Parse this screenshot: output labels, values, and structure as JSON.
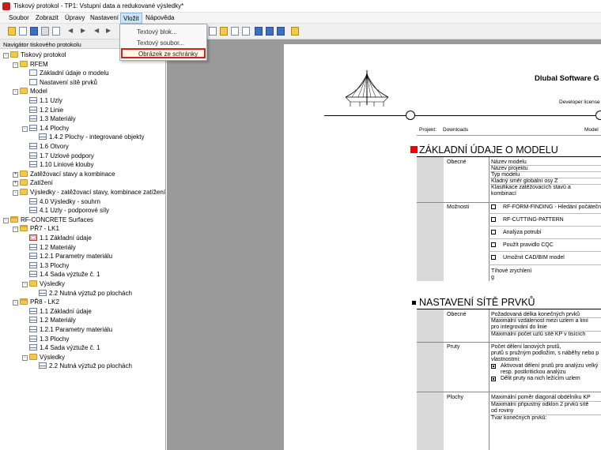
{
  "window": {
    "title": "Tiskový protokol - TP1: Vstupní data a redukované výsledky*"
  },
  "menu": {
    "items": [
      "Soubor",
      "Zobrazit",
      "Úpravy",
      "Nastavení",
      "Vložit",
      "Nápověda"
    ],
    "active": "Vložit"
  },
  "dropdown": {
    "items": [
      "Textový blok...",
      "Textový soubor...",
      "Obrázek ze schránky"
    ],
    "highlighted": "Obrázek ze schránky"
  },
  "navigator": {
    "title": "Navigátor tiskového protokolu",
    "tree": [
      {
        "label": "Tiskový protokol",
        "icon": "folder-icon",
        "toggle": "-"
      },
      {
        "label": "RFEM",
        "icon": "folder-icon",
        "toggle": "-"
      },
      {
        "label": "Základní údaje o modelu",
        "icon": "document-icon",
        "toggle": ""
      },
      {
        "label": "Nastavení sítě prvků",
        "icon": "document-icon",
        "toggle": ""
      },
      {
        "label": "Model",
        "icon": "folder-icon",
        "toggle": "-"
      },
      {
        "label": "1.1 Uzly",
        "icon": "table-icon",
        "toggle": ""
      },
      {
        "label": "1.2 Linie",
        "icon": "table-icon",
        "toggle": ""
      },
      {
        "label": "1.3 Materiály",
        "icon": "table-icon",
        "toggle": ""
      },
      {
        "label": "1.4 Plochy",
        "icon": "table-icon",
        "toggle": "-"
      },
      {
        "label": "1.4.2 Plochy - integrované objekty",
        "icon": "table-icon",
        "toggle": ""
      },
      {
        "label": "1.6 Otvory",
        "icon": "table-icon",
        "toggle": ""
      },
      {
        "label": "1.7 Uzlové podpory",
        "icon": "table-icon",
        "toggle": ""
      },
      {
        "label": "1.10 Liniové klouby",
        "icon": "table-icon",
        "toggle": ""
      },
      {
        "label": "Zatěžovací stavy a kombinace",
        "icon": "folder-icon",
        "toggle": "+"
      },
      {
        "label": "Zatížení",
        "icon": "folder-icon",
        "toggle": "+"
      },
      {
        "label": "Výsledky - zatěžovací stavy, kombinace zatížení",
        "icon": "folder-icon",
        "toggle": "-"
      },
      {
        "label": "4.0 Výsledky - souhrn",
        "icon": "table-icon",
        "toggle": ""
      },
      {
        "label": "4.1 Uzly - podporové síly",
        "icon": "table-icon",
        "toggle": ""
      },
      {
        "label": "RF-CONCRETE Surfaces",
        "icon": "module-folder-icon",
        "toggle": "-"
      },
      {
        "label": "PŘ7 - LK1",
        "icon": "module-folder-icon",
        "toggle": "-"
      },
      {
        "label": "1.1 Základní údaje",
        "icon": "red-table-icon",
        "toggle": ""
      },
      {
        "label": "1.2 Materiály",
        "icon": "table-icon",
        "toggle": ""
      },
      {
        "label": "1.2.1 Parametry materiálu",
        "icon": "table-icon",
        "toggle": ""
      },
      {
        "label": "1.3 Plochy",
        "icon": "table-icon",
        "toggle": ""
      },
      {
        "label": "1.4 Sada výztuže č. 1",
        "icon": "table-icon",
        "toggle": ""
      },
      {
        "label": "Výsledky",
        "icon": "folder-icon",
        "toggle": "-"
      },
      {
        "label": "2.2 Nutná výztuž po plochách",
        "icon": "table-icon",
        "toggle": ""
      },
      {
        "label": "PŘ8 - LK2",
        "icon": "module-folder-icon",
        "toggle": "-"
      },
      {
        "label": "1.1 Základní údaje",
        "icon": "table-icon",
        "toggle": ""
      },
      {
        "label": "1.2 Materiály",
        "icon": "table-icon",
        "toggle": ""
      },
      {
        "label": "1.2.1 Parametry materiálu",
        "icon": "table-icon",
        "toggle": ""
      },
      {
        "label": "1.3 Plochy",
        "icon": "table-icon",
        "toggle": ""
      },
      {
        "label": "1.4 Sada výztuže č. 1",
        "icon": "table-icon",
        "toggle": ""
      },
      {
        "label": "Výsledky",
        "icon": "folder-icon",
        "toggle": "-"
      },
      {
        "label": "2.2 Nutná výztuž po plochách",
        "icon": "table-icon",
        "toggle": ""
      }
    ]
  },
  "report": {
    "company": "Dlubal Software G",
    "license": "Developer license",
    "project_label": "Projekt:",
    "project_value": "Downloads",
    "model_label": "Model",
    "section1": {
      "title": "ZÁKLADNÍ ÚDAJE O MODELU",
      "group1_label": "Obecné",
      "group1_rows": [
        "Název modelu",
        "Název projektu",
        "Typ modelu",
        "Kladný směr globální osy Z",
        "Klasifikace zatěžovacích stavů a",
        "kombinací"
      ],
      "group2_label": "Možnosti",
      "options": [
        {
          "label": "RF-FORM-FINDING - Hledání počátečn",
          "checked": false
        },
        {
          "label": "RF-CUTTING-PATTERN",
          "checked": false
        },
        {
          "label": "Analýza potrubí",
          "checked": false
        },
        {
          "label": "Použít pravidlo CQC",
          "checked": false
        },
        {
          "label": "Umožnit CAD/BIM model",
          "checked": false
        }
      ],
      "gravity_label": "Tíhové zrychlení",
      "gravity_symbol": "g"
    },
    "section2": {
      "title": "NASTAVENÍ SÍTĚ PRVKŮ",
      "general_label": "Obecné",
      "general_rows": [
        "Požadovaná délka konečných prvků",
        "Maximální vzdálenost mezi uzlem a linií",
        "pro integrování do linie",
        "Maximální počet uzlů sítě KP v tisících"
      ],
      "members_label": "Pruty",
      "members_rows": [
        "Počet dělení lanových prutů,",
        "prutů s pružným podložím, s náběhy nebo p",
        "vlastnostmi:"
      ],
      "member_options": [
        {
          "label": "Aktivovat dělení prutů pro analýzu velký",
          "checked": true
        },
        {
          "label": "resp. postkritickou analýzu",
          "checked": null
        },
        {
          "label": "Dělit pruty na nich ležícím uzlem",
          "checked": true
        }
      ],
      "surfaces_label": "Plochy",
      "surfaces_rows": [
        "Maximální poměr diagonál obdélníku KP",
        "Maximální přípustný odklon 2 prvků sítě",
        "od roviny",
        "Tvar konečných prvků:"
      ]
    }
  }
}
